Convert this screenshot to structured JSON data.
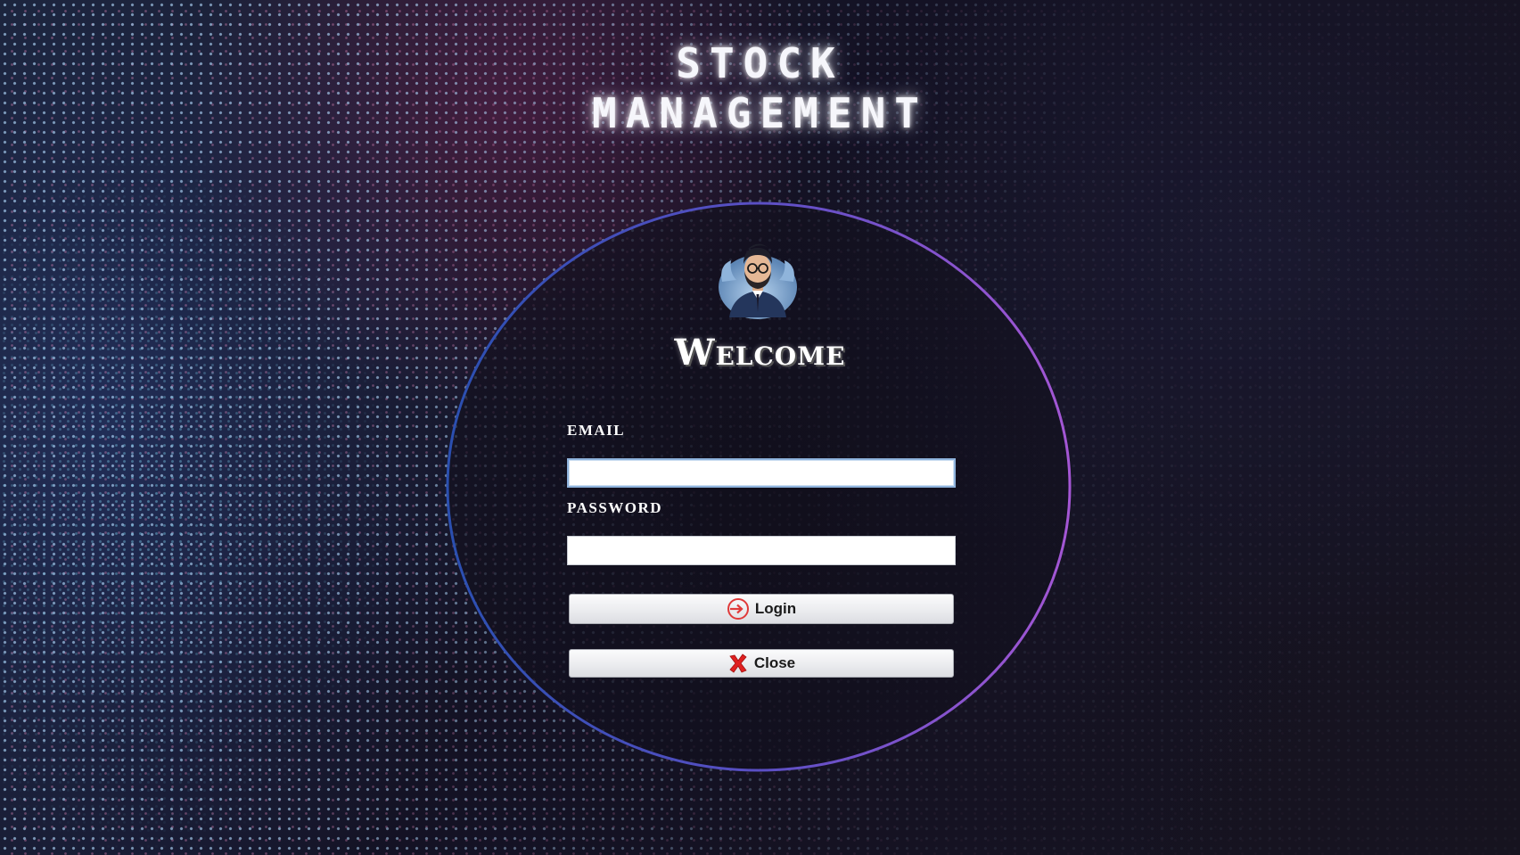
{
  "app": {
    "title_line1": "STOCK",
    "title_line2": "MANAGEMENT"
  },
  "login_form": {
    "welcome": "Welcome",
    "email_label": "EMAIL",
    "email_value": "",
    "password_label": "PASSWORD",
    "password_value": "",
    "login_button": "Login",
    "close_button": "Close"
  },
  "icons": {
    "login": "login-arrow-icon",
    "close": "red-x-icon",
    "avatar": "user-avatar"
  },
  "colors": {
    "background": "#14121f",
    "ring_start": "#2a4fb0",
    "ring_end": "#9b4fcf",
    "login_icon": "#e03a3a",
    "close_icon": "#e02020"
  }
}
